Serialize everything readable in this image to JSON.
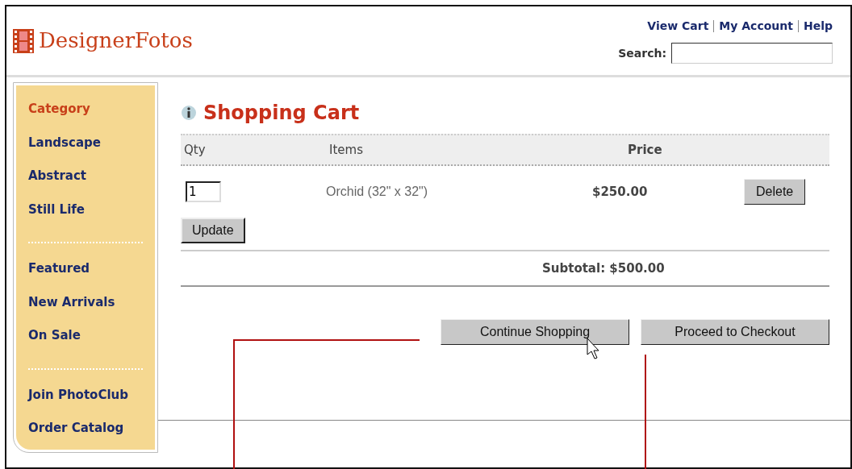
{
  "header": {
    "logo": "DesignerFotos",
    "links": [
      "View Cart",
      "My Account",
      "Help"
    ],
    "search": {
      "label": "Search:"
    }
  },
  "sidebar": {
    "groups": [
      {
        "items": [
          {
            "label": "Category",
            "kind": "heading"
          },
          {
            "label": "Landscape",
            "kind": "link"
          },
          {
            "label": "Abstract",
            "kind": "link"
          },
          {
            "label": "Still Life",
            "kind": "link"
          }
        ]
      },
      {
        "items": [
          {
            "label": "Featured",
            "kind": "link"
          },
          {
            "label": "New Arrivals",
            "kind": "link"
          },
          {
            "label": "On Sale",
            "kind": "link"
          }
        ]
      },
      {
        "items": [
          {
            "label": "Join PhotoClub",
            "kind": "link"
          },
          {
            "label": "Order Catalog",
            "kind": "link"
          }
        ]
      }
    ]
  },
  "cart": {
    "title": "Shopping Cart",
    "columns": [
      "Qty",
      "Items",
      "Price"
    ],
    "rows": [
      {
        "qty": "1",
        "item": "Orchid (32\" x 32\")",
        "price": "$250.00",
        "action": "Delete"
      }
    ],
    "update_button": "Update",
    "subtotal": "Subtotal: $500.00",
    "buttons": [
      "Continue Shopping",
      "Proceed to Checkout"
    ]
  }
}
